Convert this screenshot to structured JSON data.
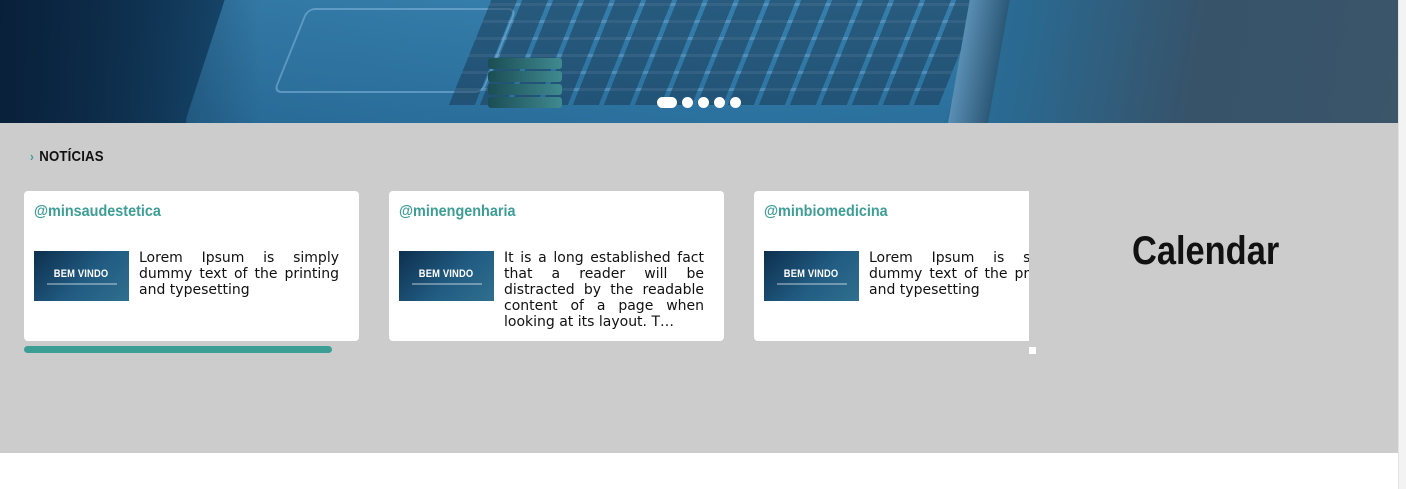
{
  "hero": {
    "slides_count": 5,
    "active_slide": 1
  },
  "news": {
    "title": "NOTÍCIAS",
    "cards": [
      {
        "handle": "@minsaudestetica",
        "thumb_title": "BEM VINDO",
        "text": "Lorem Ipsum is simply dummy text of the printing and typesetting"
      },
      {
        "handle": "@minengenharia",
        "thumb_title": "BEM VINDO",
        "text": "It is a long established fact that a reader will be distracted by the readable content of a page when looking at its layout. T…"
      },
      {
        "handle": "@minbiomedicina",
        "thumb_title": "BEM VINDO",
        "text": "Lorem Ipsum is simply dummy text of the printing and typesetting"
      }
    ],
    "progress": 0.31
  },
  "calendar": {
    "title": "Calendar"
  },
  "colors": {
    "accent": "#3d9e96",
    "section_bg": "#cccccc"
  }
}
